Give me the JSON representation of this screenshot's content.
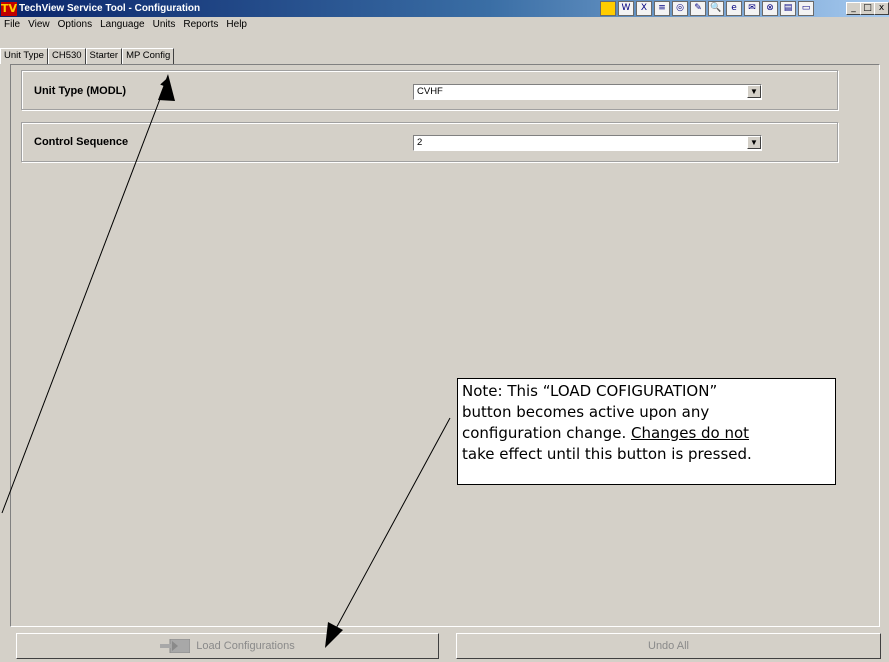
{
  "window": {
    "logo": "TV",
    "title": "TechView Service Tool - Configuration",
    "controls": {
      "minimize": "_",
      "maximize": "□",
      "close": "x"
    }
  },
  "tray_icons": [
    "W",
    "X",
    "≡",
    "◎",
    "✎",
    "🔍",
    "e",
    "✉",
    "⊗",
    "▤",
    "▭"
  ],
  "menu": [
    "File",
    "View",
    "Options",
    "Language",
    "Units",
    "Reports",
    "Help"
  ],
  "tabs": [
    {
      "label": "Unit Type",
      "active": true
    },
    {
      "label": "CH530",
      "active": false
    },
    {
      "label": "Starter",
      "active": false
    },
    {
      "label": "MP Config",
      "active": false
    }
  ],
  "fields": {
    "unit_type": {
      "label": "Unit Type (MODL)",
      "value": "CVHF"
    },
    "control_sequence": {
      "label": "Control Sequence",
      "value": "2"
    }
  },
  "buttons": {
    "load": "Load Configurations",
    "undo": "Undo All"
  },
  "note": {
    "line1": "Note: This “LOAD COFIGURATION”",
    "line2": "button becomes active upon any",
    "line3a": "configuration change. ",
    "line3b": "Changes do not",
    "line4": "take effect until this button is pressed."
  },
  "colors": {
    "window_bg": "#d4d0c8",
    "title_start": "#0a246a",
    "title_end": "#a6caf0",
    "disabled_text": "#8a8a8a"
  }
}
